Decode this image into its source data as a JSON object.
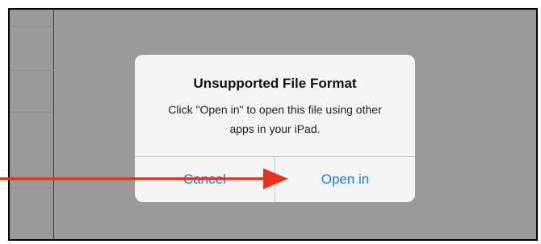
{
  "dialog": {
    "title": "Unsupported File Format",
    "message": "Click \"Open in\" to open this file using other apps in your iPad.",
    "cancel_label": "Cancel",
    "open_label": "Open in"
  },
  "colors": {
    "button_text": "#1a7cf0",
    "overlay_background": "#9a9a9a",
    "dialog_background": "#f4f4f4",
    "annotation_arrow": "#e8321e"
  },
  "annotation": {
    "arrow_target": "open-in-button"
  }
}
